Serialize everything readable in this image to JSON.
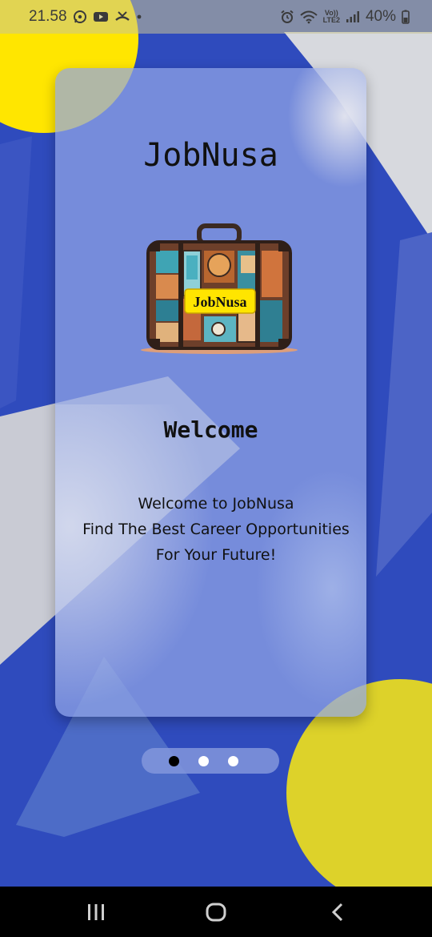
{
  "status_bar": {
    "time": "21.58",
    "icons": [
      "whatsapp-icon",
      "youtube-icon",
      "missed-call-icon",
      "dot-icon"
    ],
    "right_icons": [
      "alarm-icon",
      "wifi-icon",
      "volte-icon",
      "signal-icon",
      "battery-icon"
    ],
    "volte_top": "Vo))",
    "volte_bottom": "LTE2",
    "battery": "40%"
  },
  "onboarding": {
    "app_title": "JobNusa",
    "logo_text": "JobNusa",
    "heading": "Welcome",
    "lines": [
      "Welcome to JobNusa",
      "Find The Best Career Opportunities",
      "For Your Future!"
    ],
    "pages": 3,
    "active_page": 1
  },
  "nav_bar": {
    "buttons": [
      "recent-apps-icon",
      "home-icon",
      "back-icon"
    ]
  },
  "colors": {
    "background": "#2f4bbd",
    "accent_yellow": "#ffe600",
    "card": "#91a5e6"
  }
}
